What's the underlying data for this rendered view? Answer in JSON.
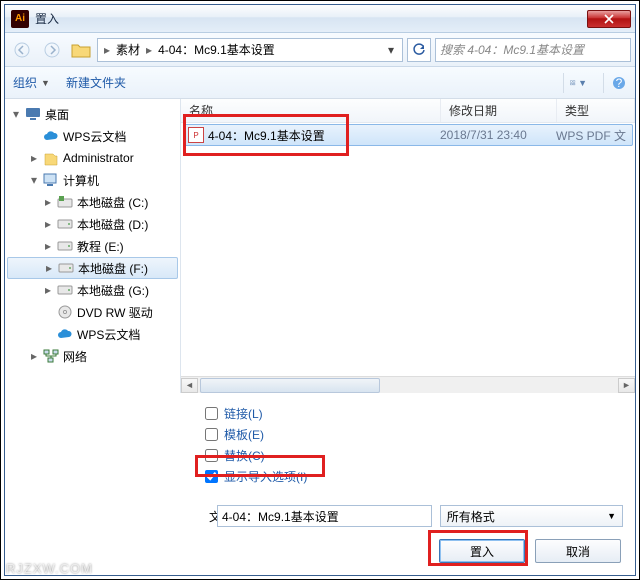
{
  "window": {
    "title": "置入"
  },
  "nav": {
    "breadcrumb": [
      "素材",
      "4-04：Mc9.1基本设置"
    ],
    "search_placeholder": "搜索 4-04：Mc9.1基本设置"
  },
  "toolbar": {
    "organize": "组织",
    "newfolder": "新建文件夹"
  },
  "sidebar": {
    "items": [
      {
        "label": "桌面",
        "icon": "desktop",
        "arrow": "▾",
        "indent": 0
      },
      {
        "label": "WPS云文档",
        "icon": "cloud",
        "arrow": "",
        "indent": 1
      },
      {
        "label": "Administrator",
        "icon": "user",
        "arrow": "▸",
        "indent": 1
      },
      {
        "label": "计算机",
        "icon": "computer",
        "arrow": "▾",
        "indent": 1
      },
      {
        "label": "本地磁盘 (C:)",
        "icon": "drive-win",
        "arrow": "▸",
        "indent": 2
      },
      {
        "label": "本地磁盘 (D:)",
        "icon": "drive",
        "arrow": "▸",
        "indent": 2
      },
      {
        "label": "教程 (E:)",
        "icon": "drive",
        "arrow": "▸",
        "indent": 2
      },
      {
        "label": "本地磁盘 (F:)",
        "icon": "drive",
        "arrow": "▸",
        "indent": 2,
        "selected": true
      },
      {
        "label": "本地磁盘 (G:)",
        "icon": "drive",
        "arrow": "▸",
        "indent": 2
      },
      {
        "label": "DVD RW 驱动",
        "icon": "dvd",
        "arrow": "",
        "indent": 2
      },
      {
        "label": "WPS云文档",
        "icon": "cloud",
        "arrow": "",
        "indent": 2
      },
      {
        "label": "网络",
        "icon": "network",
        "arrow": "▸",
        "indent": 1
      }
    ]
  },
  "columns": {
    "name": "名称",
    "date": "修改日期",
    "type": "类型"
  },
  "files": [
    {
      "name": "4-04：Mc9.1基本设置",
      "date": "2018/7/31 23:40",
      "type": "WPS PDF 文",
      "selected": true
    }
  ],
  "options": {
    "link": "链接(L)",
    "template": "模板(E)",
    "replace": "替换(C)",
    "showimport": "显示导入选项(I)",
    "showimport_checked": true
  },
  "bottom": {
    "filename_label": "文件名(N):",
    "filename_value": "4-04：Mc9.1基本设置",
    "format": "所有格式",
    "place": "置入",
    "cancel": "取消"
  },
  "watermark": "RJZXW.COM"
}
